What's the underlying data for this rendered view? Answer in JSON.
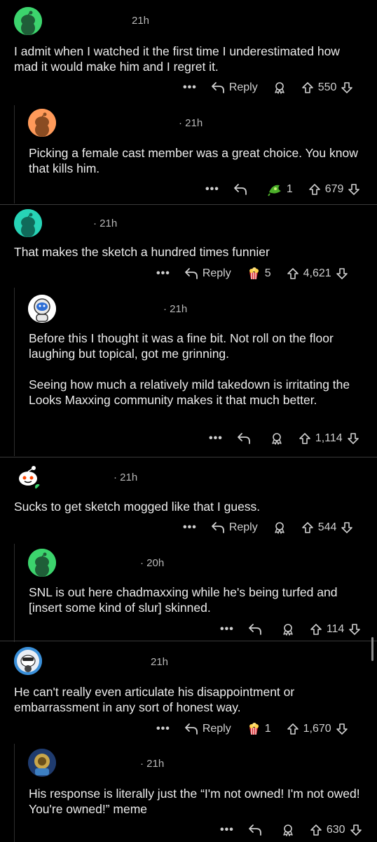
{
  "comments": [
    {
      "time": "21h",
      "text": [
        "I admit when I watched it the first time I underestimated how mad it would make him and I regret it."
      ],
      "reply_label": "Reply",
      "award_count": "",
      "score": "550"
    },
    {
      "time": "· 21h",
      "text": [
        "Picking a female cast member was a great choice. You know that kills him."
      ],
      "reply_label": "",
      "award_count": "1",
      "score": "679"
    },
    {
      "time": "· 21h",
      "text": [
        "That makes the sketch a hundred times funnier"
      ],
      "reply_label": "Reply",
      "award_count": "5",
      "score": "4,621"
    },
    {
      "time": "· 21h",
      "text": [
        "Before this I thought it was a fine bit. Not roll on the floor laughing but topical, got me grinning.",
        "Seeing how much a relatively mild takedown is irritating the Looks Maxxing community makes it that much better."
      ],
      "reply_label": "",
      "award_count": "",
      "score": "1,114"
    },
    {
      "time": "· 21h",
      "text": [
        "Sucks to get sketch mogged like that I guess."
      ],
      "reply_label": "Reply",
      "award_count": "",
      "score": "544"
    },
    {
      "time": "· 20h",
      "text": [
        "SNL is out here chadmaxxing while he's being turfed and [insert some kind of slur] skinned."
      ],
      "reply_label": "",
      "award_count": "",
      "score": "114"
    },
    {
      "time": "21h",
      "text": [
        "He can't really even articulate his disappointment or embarrassment in any sort of honest way."
      ],
      "reply_label": "Reply",
      "award_count": "1",
      "score": "1,670"
    },
    {
      "time": "· 21h",
      "text": [
        "His response is literally just the “I'm not owned! I'm not owed! You're owned!” meme"
      ],
      "reply_label": "",
      "award_count": "",
      "score": "630"
    }
  ],
  "icons": {
    "more": "more-icon",
    "reply": "reply-icon",
    "award": "award-icon",
    "upvote": "upvote-icon",
    "downvote": "downvote-icon"
  },
  "colors": {
    "background": "#000000",
    "text": "#ececec",
    "meta": "#b8b8b8",
    "avatar_green": "#3cd46d",
    "avatar_teal": "#27d3b6",
    "avatar_orange": "#ff9a5a"
  }
}
